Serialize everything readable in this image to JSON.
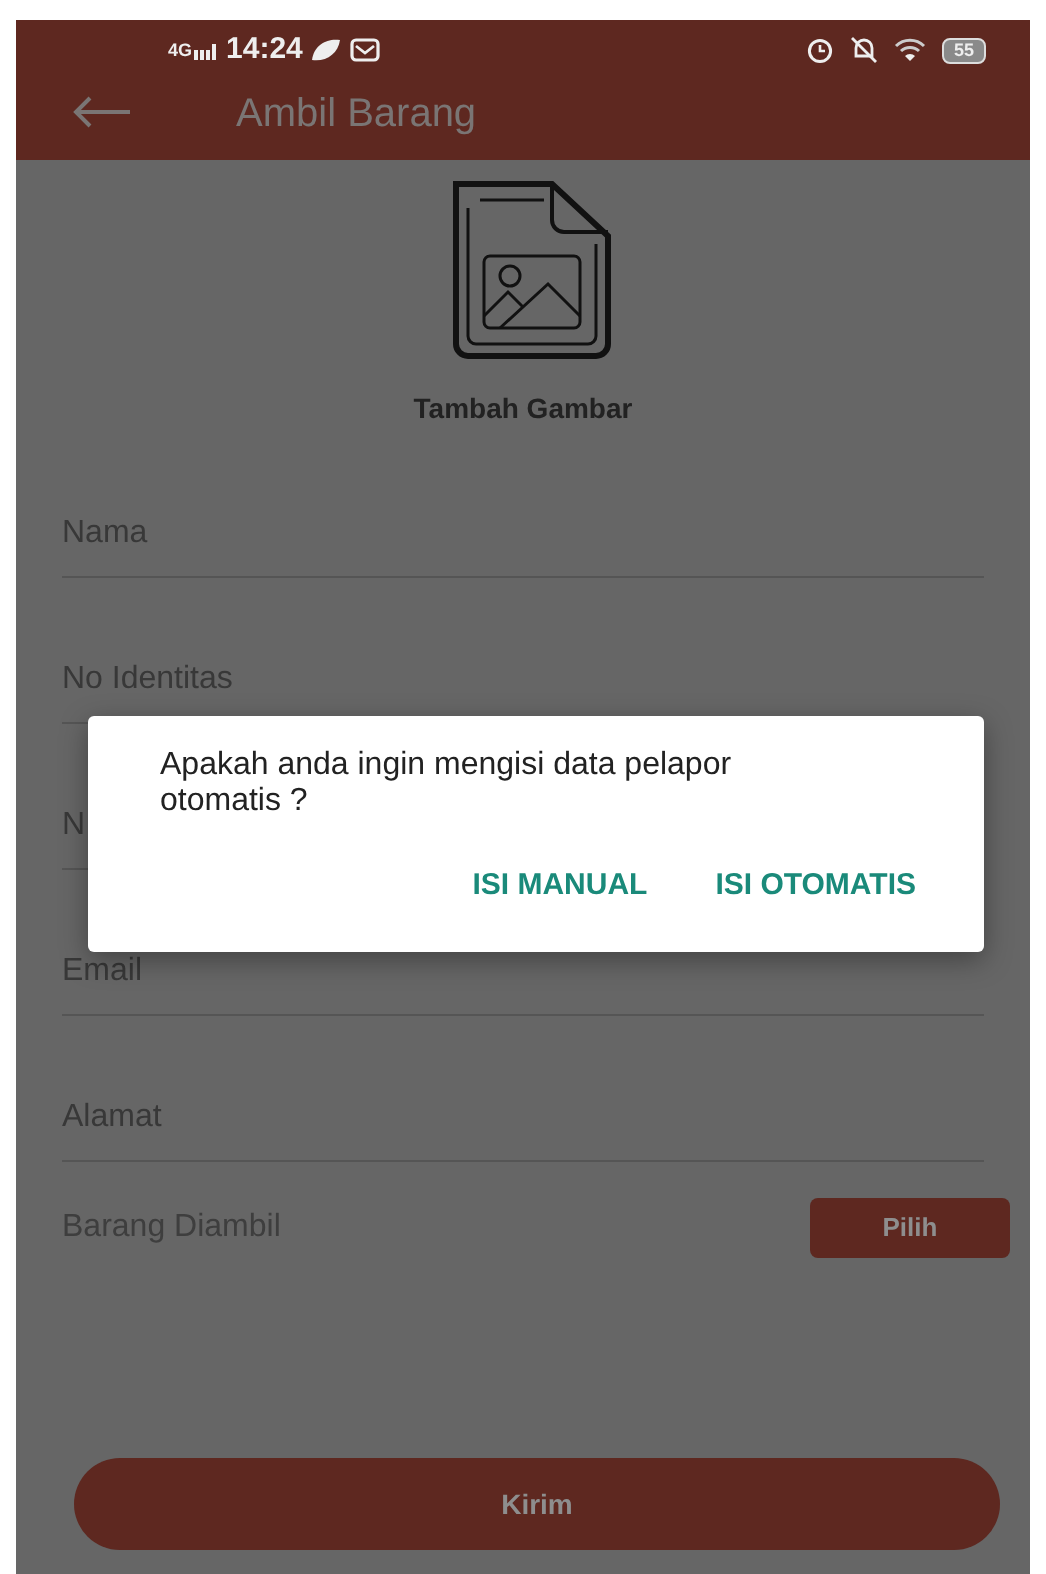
{
  "status_bar": {
    "network": "4G",
    "time": "14:24",
    "battery": "55"
  },
  "app_bar": {
    "title": "Ambil Barang"
  },
  "image_picker": {
    "label": "Tambah Gambar"
  },
  "fields": [
    {
      "label": "Nama"
    },
    {
      "label": "No Identitas"
    },
    {
      "label": "N"
    },
    {
      "label": "Email"
    },
    {
      "label": "Alamat"
    }
  ],
  "item_row": {
    "label": "Barang Diambil",
    "button": "Pilih"
  },
  "submit_button": "Kirim",
  "dialog": {
    "message": "Apakah anda ingin mengisi data pelapor otomatis ?",
    "buttons": [
      "ISI MANUAL",
      "ISI OTOMATIS"
    ]
  }
}
